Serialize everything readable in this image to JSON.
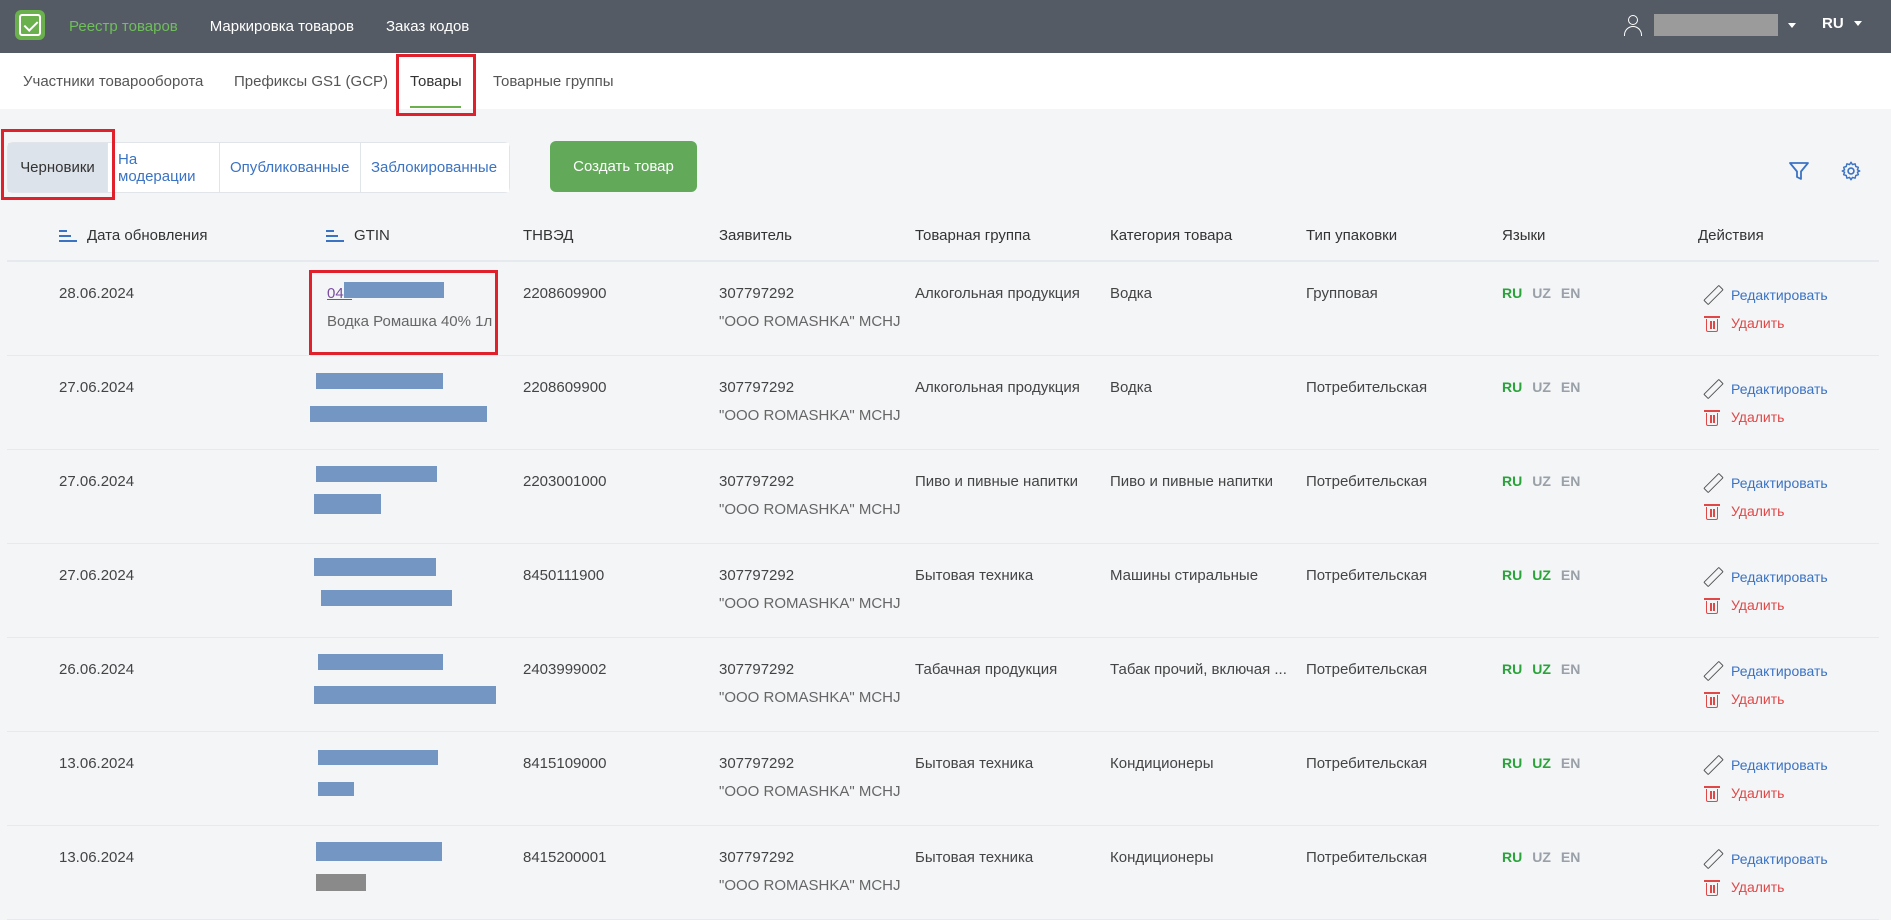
{
  "topbar": {
    "nav": [
      "Реестр товаров",
      "Маркировка товаров",
      "Заказ кодов"
    ],
    "lang": "RU"
  },
  "subnav": {
    "tabs": [
      "Участники товарооборота",
      "Префиксы GS1 (GCP)",
      "Товары",
      "Товарные группы"
    ]
  },
  "filters": {
    "tabs": [
      "Черновики",
      "На модерации",
      "Опубликованные",
      "Заблокированные"
    ],
    "create_button": "Создать товар"
  },
  "table": {
    "columns": [
      "Дата обновления",
      "GTIN",
      "ТНВЭД",
      "Заявитель",
      "Товарная группа",
      "Категория товара",
      "Тип упаковки",
      "Языки",
      "Действия"
    ],
    "rows": [
      {
        "date": "28.06.2024",
        "gtin": "046",
        "name": "Водка Ромашка 40% 1л",
        "tnved": "2208609900",
        "inn": "307797292",
        "company": "\"OOO ROMASHKA\" MCHJ",
        "group": "Алкогольная продукция",
        "category": "Водка",
        "pack": "Групповая",
        "langs": {
          "RU": "on",
          "UZ": "off",
          "EN": "off"
        }
      },
      {
        "date": "27.06.2024",
        "gtin": "",
        "name": "",
        "tnved": "2208609900",
        "inn": "307797292",
        "company": "\"OOO ROMASHKA\" MCHJ",
        "group": "Алкогольная продукция",
        "category": "Водка",
        "pack": "Потребительская",
        "langs": {
          "RU": "on",
          "UZ": "off",
          "EN": "off"
        }
      },
      {
        "date": "27.06.2024",
        "gtin": "",
        "name": "",
        "tnved": "2203001000",
        "inn": "307797292",
        "company": "\"OOO ROMASHKA\" MCHJ",
        "group": "Пиво и пивные напитки",
        "category": "Пиво и пивные напитки",
        "pack": "Потребительская",
        "langs": {
          "RU": "on",
          "UZ": "off",
          "EN": "off"
        }
      },
      {
        "date": "27.06.2024",
        "gtin": "",
        "name": "",
        "tnved": "8450111900",
        "inn": "307797292",
        "company": "\"OOO ROMASHKA\" MCHJ",
        "group": "Бытовая техника",
        "category": "Машины стиральные",
        "pack": "Потребительская",
        "langs": {
          "RU": "on",
          "UZ": "on",
          "EN": "off"
        }
      },
      {
        "date": "26.06.2024",
        "gtin": "",
        "name": "",
        "tnved": "2403999002",
        "inn": "307797292",
        "company": "\"OOO ROMASHKA\" MCHJ",
        "group": "Табачная продукция",
        "category": "Табак прочий, включая ...",
        "pack": "Потребительская",
        "langs": {
          "RU": "on",
          "UZ": "on",
          "EN": "off"
        }
      },
      {
        "date": "13.06.2024",
        "gtin": "",
        "name": "",
        "tnved": "8415109000",
        "inn": "307797292",
        "company": "\"OOO ROMASHKA\" MCHJ",
        "group": "Бытовая техника",
        "category": "Кондиционеры",
        "pack": "Потребительская",
        "langs": {
          "RU": "on",
          "UZ": "on",
          "EN": "off"
        }
      },
      {
        "date": "13.06.2024",
        "gtin": "",
        "name": "",
        "tnved": "8415200001",
        "inn": "307797292",
        "company": "\"OOO ROMASHKA\" MCHJ",
        "group": "Бытовая техника",
        "category": "Кондиционеры",
        "pack": "Потребительская",
        "langs": {
          "RU": "on",
          "UZ": "off",
          "EN": "off"
        }
      }
    ],
    "actions": {
      "edit": "Редактировать",
      "delete": "Удалить"
    }
  },
  "colors": {
    "topbar": "#545b64",
    "accent_green": "#62a95a",
    "link_blue": "#3b73c4",
    "danger": "#e04848",
    "highlight": "#e0202a"
  }
}
